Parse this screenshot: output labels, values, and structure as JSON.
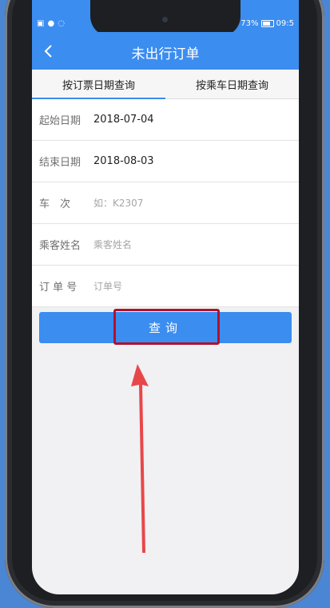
{
  "status_bar": {
    "battery": "73%",
    "time": "09:5"
  },
  "header": {
    "title": "未出行订单"
  },
  "tabs": [
    {
      "label": "按订票日期查询",
      "active": true
    },
    {
      "label": "按乘车日期查询",
      "active": false
    }
  ],
  "form": {
    "start_date": {
      "label": "起始日期",
      "value": "2018-07-04"
    },
    "end_date": {
      "label": "结束日期",
      "value": "2018-08-03"
    },
    "train_no": {
      "label": "车　次",
      "placeholder": "如：K2307"
    },
    "passenger": {
      "label": "乘客姓名",
      "placeholder": "乘客姓名"
    },
    "order_no": {
      "label": "订 单 号",
      "placeholder": "订单号"
    }
  },
  "actions": {
    "query_label": "查询"
  },
  "colors": {
    "accent": "#3b8df0",
    "background": "#4a86d4",
    "highlight": "#b1112b",
    "arrow": "#e8474a"
  }
}
